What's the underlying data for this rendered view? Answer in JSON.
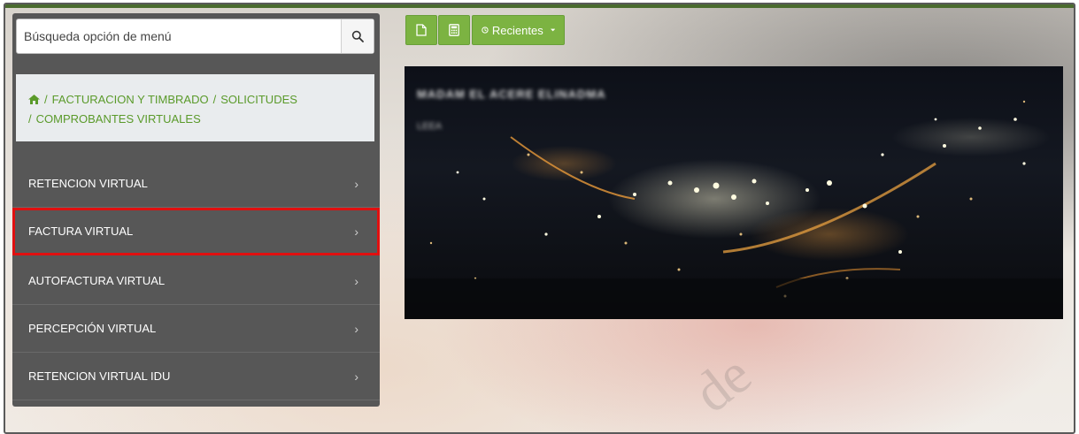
{
  "search": {
    "placeholder": "Búsqueda opción de menú"
  },
  "breadcrumb": {
    "home_icon": "home-icon",
    "items": [
      "FACTURACION Y TIMBRADO",
      "SOLICITUDES",
      "COMPROBANTES VIRTUALES"
    ]
  },
  "menu": {
    "items": [
      {
        "label": "RETENCION VIRTUAL"
      },
      {
        "label": "FACTURA VIRTUAL",
        "highlighted": true
      },
      {
        "label": "AUTOFACTURA VIRTUAL"
      },
      {
        "label": "PERCEPCIÓN VIRTUAL"
      },
      {
        "label": "RETENCION VIRTUAL IDU"
      }
    ]
  },
  "toolbar": {
    "recientes_label": "Recientes",
    "icons": [
      "document-icon",
      "calculator-icon",
      "clock-icon",
      "caret-down-icon"
    ]
  },
  "banner": {
    "title": "MADAM EL ACERE ELINADMA",
    "subtitle": "LEEA"
  },
  "watermark": {
    "text": "de"
  },
  "colors": {
    "accent_green": "#7cb342",
    "panel_bg": "#575757",
    "breadcrumb_text": "#5a9a2a",
    "highlight_red": "#e01010",
    "frame_top": "#4a6b2e"
  }
}
